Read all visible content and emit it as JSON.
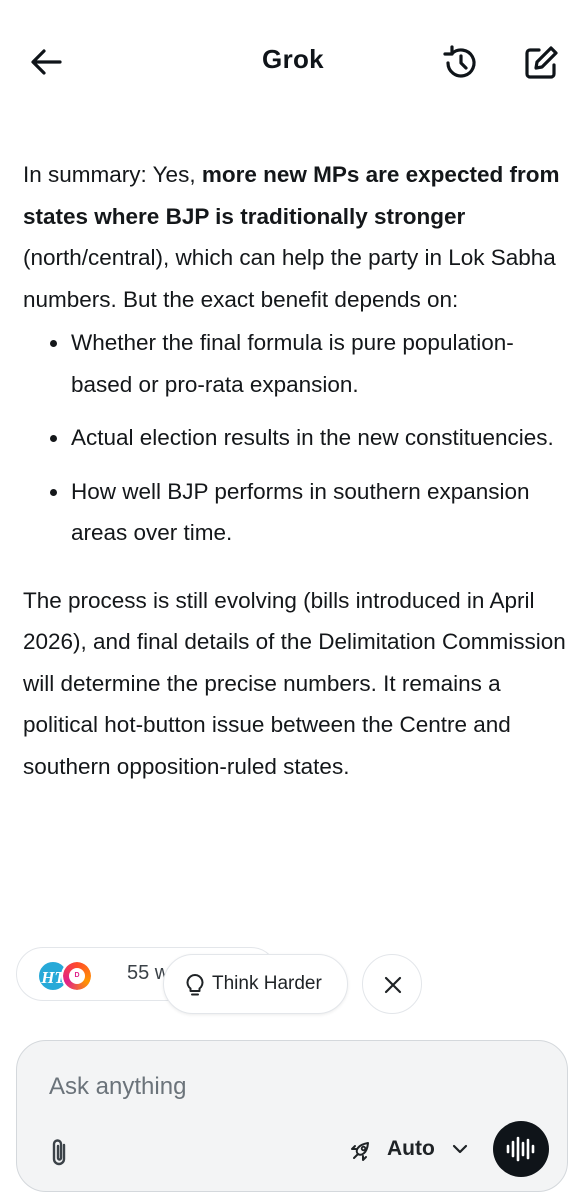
{
  "header": {
    "title": "Grok",
    "back_icon": "arrow-left-icon",
    "history_icon": "history-icon",
    "new_chat_icon": "edit-icon"
  },
  "message": {
    "para1_lead": "In summary: Yes, ",
    "para1_bold": "more new MPs are expected from states where BJP is traditionally stronger",
    "para1_rest": " (north/central), which can help the party in Lok Sabha numbers. But the exact benefit depends on:",
    "bullets": [
      "Whether the final formula is pure population-based or pro-rata expansion.",
      "Actual election results in the new constituencies.",
      "How well BJP performs in southern expansion areas over time."
    ],
    "para2": "The process is still evolving (bills introduced in April 2026), and final details of the Delimitation Commission will determine the precise numbers. It remains a political hot-button issue between the Centre and southern opposition-ruled states."
  },
  "sources": {
    "logo1": "HT",
    "logo2": "INDIA TODAY",
    "count_text": "55 w"
  },
  "suggestion": {
    "label": "Think Harder",
    "icon": "lightbulb-icon"
  },
  "composer": {
    "placeholder": "Ask anything",
    "mode": "Auto",
    "attach_icon": "paperclip-icon",
    "mode_icon": "rocket-icon",
    "voice_icon": "waveform-icon"
  },
  "colors": {
    "text": "#0f1419",
    "composer_bg": "#f3f4f5",
    "voice_button": "#0f1419",
    "ht_blue": "#27a9d8"
  }
}
